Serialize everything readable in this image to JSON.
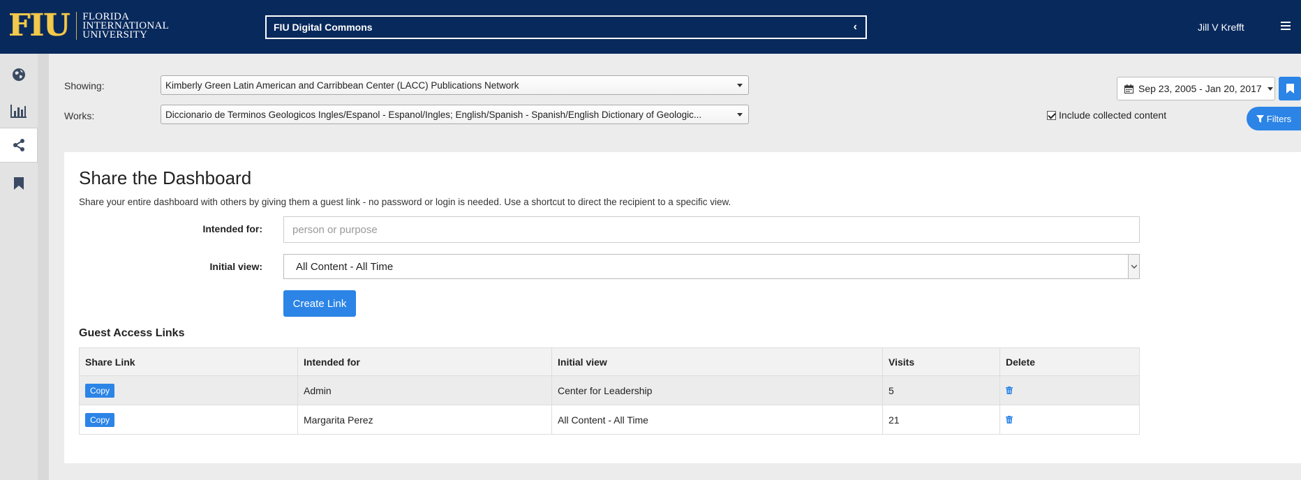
{
  "header": {
    "logo_mark": "FIU",
    "logo_lines": [
      "FLORIDA",
      "INTERNATIONAL",
      "UNIVERSITY"
    ],
    "site_selector": "FIU Digital Commons",
    "user_name": "Jill V Krefft"
  },
  "filters": {
    "showing_label": "Showing:",
    "showing_value": "Kimberly Green Latin American and Carribbean Center (LACC) Publications Network",
    "works_label": "Works:",
    "works_value": "Diccionario de Terminos Geologicos Ingles/Espanol - Espanol/Ingles; English/Spanish - Spanish/English Dictionary of Geologic...",
    "date_range": "Sep 23, 2005 - Jan 20, 2017",
    "include_collected_label": "Include collected content",
    "filters_button": "Filters"
  },
  "share": {
    "title": "Share the Dashboard",
    "description": "Share your entire dashboard with others by giving them a guest link - no password or login is needed. Use a shortcut to direct the recipient to a specific view.",
    "intended_label": "Intended for:",
    "intended_placeholder": "person or purpose",
    "initial_view_label": "Initial view:",
    "initial_view_value": "All Content - All Time",
    "create_button": "Create Link"
  },
  "guest_links": {
    "title": "Guest Access Links",
    "columns": [
      "Share Link",
      "Intended for",
      "Initial view",
      "Visits",
      "Delete"
    ],
    "copy_label": "Copy",
    "rows": [
      {
        "intended_for": "Admin",
        "initial_view": "Center for Leadership",
        "visits": "5"
      },
      {
        "intended_for": "Margarita Perez",
        "initial_view": "All Content - All Time",
        "visits": "21"
      }
    ]
  },
  "colors": {
    "header_bg": "#08295c",
    "accent": "#2b84e6",
    "logo_gold": "#f2c94c"
  }
}
